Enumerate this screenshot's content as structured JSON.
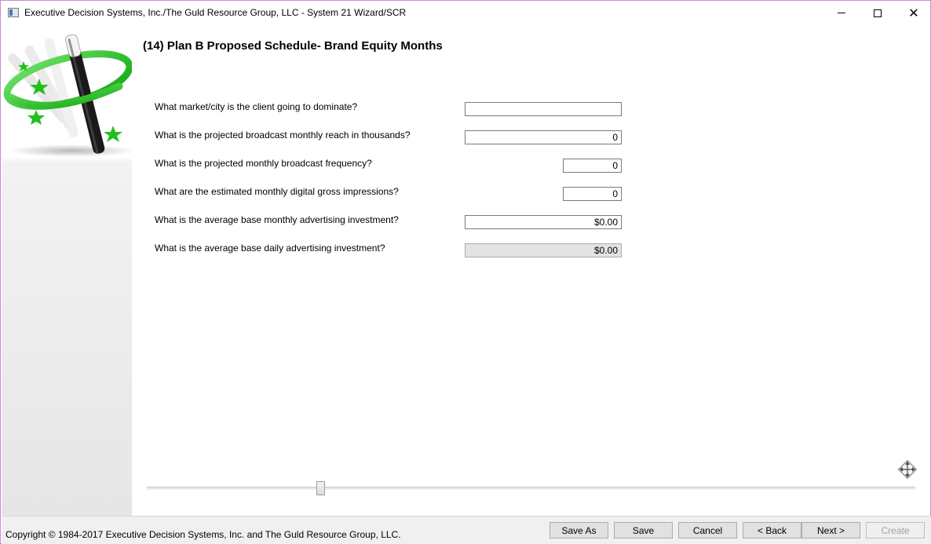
{
  "window": {
    "title": "Executive Decision Systems, Inc./The Guld Resource Group, LLC - System 21 Wizard/SCR",
    "minimize_icon": "minimize-icon",
    "maximize_icon": "maximize-icon",
    "close_label": "✕"
  },
  "page": {
    "title": "(14) Plan B Proposed Schedule- Brand Equity Months"
  },
  "questions": [
    {
      "label": "What market/city is the client going to dominate?",
      "value": "",
      "readonly": false
    },
    {
      "label": "What is the projected broadcast monthly reach in thousands?",
      "value": "0",
      "readonly": false
    },
    {
      "label": "What is the projected monthly broadcast frequency?",
      "value": "0",
      "readonly": false
    },
    {
      "label": "What are the estimated monthly digital gross impressions?",
      "value": "0",
      "readonly": false
    },
    {
      "label": "What is the average base monthly advertising investment?",
      "value": "$0.00",
      "readonly": false
    },
    {
      "label": "What is the average base daily advertising investment?",
      "value": "$0.00",
      "readonly": true
    }
  ],
  "slider": {
    "position_fraction": 0.226
  },
  "footer": {
    "copyright": "Copyright © 1984-2017 Executive Decision Systems, Inc. and The Guld Resource Group, LLC.",
    "buttons": {
      "save_as": "Save As",
      "save": "Save",
      "cancel": "Cancel",
      "back": "< Back",
      "next": "Next >",
      "create": "Create"
    }
  },
  "colors": {
    "accent_green": "#22c01e",
    "window_border": "#c98bd0"
  }
}
